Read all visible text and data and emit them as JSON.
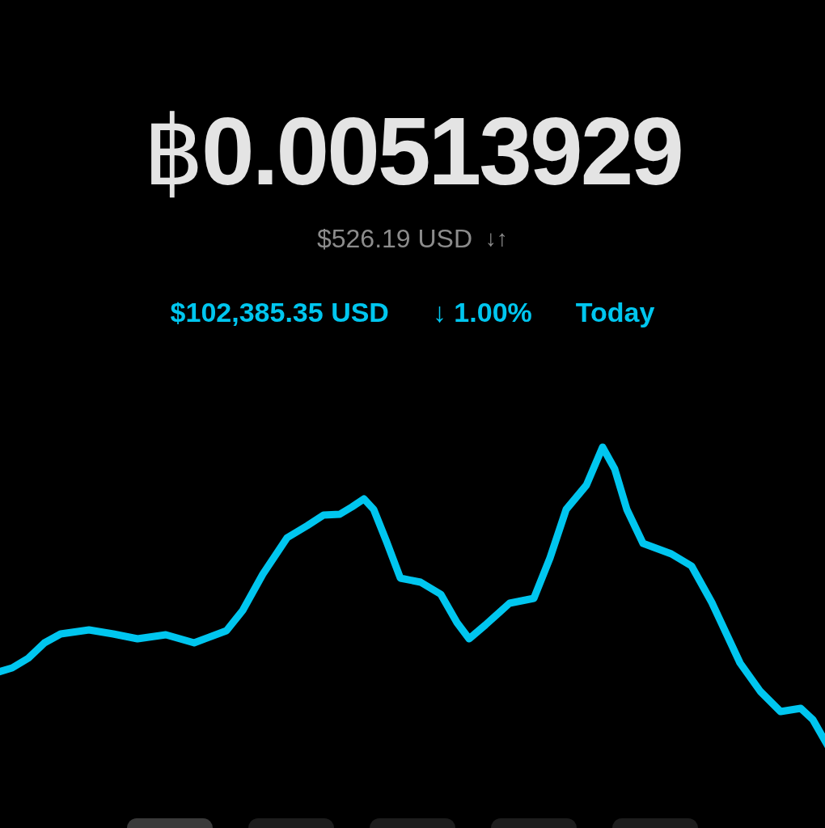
{
  "balance": {
    "amount": "฿**0.00513929**",
    "fiat_value": "$526.19 USD",
    "swap": "↓↑"
  },
  "price_row": {
    "price": "$102,385.35 USD",
    "change": "↓ 1.00%",
    "period": "Today"
  },
  "range_buttons": [
    {
      "selected": true
    },
    {
      "selected": false
    },
    {
      "selected": false
    },
    {
      "selected": false
    },
    {
      "selected": false
    }
  ]
}
